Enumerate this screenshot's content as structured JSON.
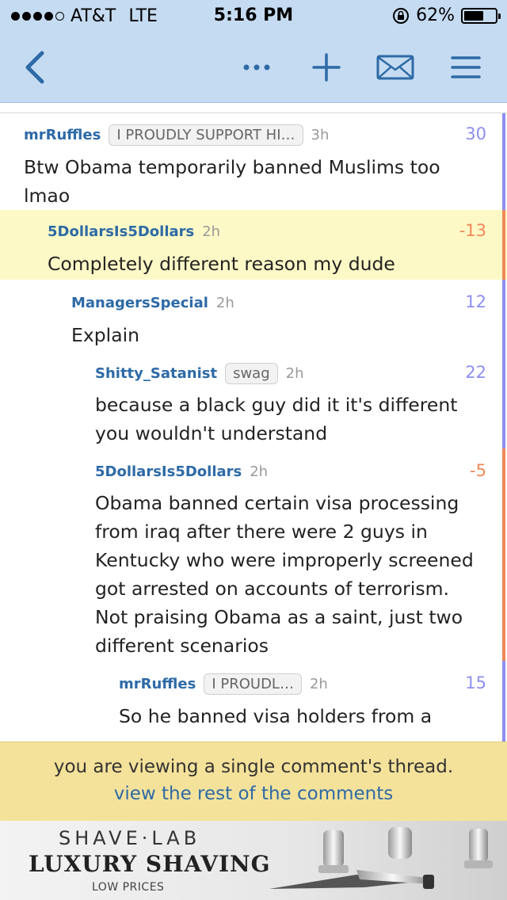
{
  "status_bar": {
    "carrier": "AT&T",
    "network": "LTE",
    "time": "5:16 PM",
    "battery": "62%",
    "battery_level": 0.62
  },
  "toolbar": {
    "icons": [
      "back-chevron-icon",
      "more-dots-icon",
      "plus-icon",
      "envelope-icon",
      "hamburger-menu-icon"
    ]
  },
  "comments": [
    {
      "author": "mrRuffles",
      "flair": "I PROUDLY SUPPORT HI…",
      "age": "3h",
      "score": "30",
      "body": [
        "Btw Obama temporarily banned Muslims too",
        "lmao"
      ]
    },
    {
      "author": "5DollarsIs5Dollars",
      "flair": "",
      "age": "2h",
      "score": "-13",
      "body": [
        "Completely different reason my dude"
      ]
    },
    {
      "author": "ManagersSpecial",
      "flair": "",
      "age": "2h",
      "score": "12",
      "body": [
        "Explain"
      ]
    },
    {
      "author": "Shitty_Satanist",
      "flair": "swag",
      "age": "2h",
      "score": "22",
      "body": [
        "because a black guy did it it's different",
        "you wouldn't understand"
      ]
    },
    {
      "author": "5DollarsIs5Dollars",
      "flair": "",
      "age": "2h",
      "score": "-5",
      "body": [
        "Obama banned certain visa processing",
        "from iraq after there were 2 guys in",
        "Kentucky who were improperly screened",
        "got arrested on accounts of terrorism.",
        "Not praising Obama as a saint, just two",
        "different scenarios"
      ]
    },
    {
      "author": "mrRuffles",
      "flair": "I PROUDL…",
      "age": "2h",
      "score": "15",
      "body": [
        "So he banned visa holders from a"
      ]
    }
  ],
  "banner": {
    "notice": "you are viewing a single comment's thread.",
    "link": "view the rest of the comments"
  },
  "ad": {
    "brand": "SHAVE·LAB",
    "tagline": "LUXURY SHAVING",
    "sub": "LOW PRICES"
  },
  "colors": {
    "header_bg": "#c5dbf1",
    "icon_blue": "#2d6aa6",
    "author": "#2d6aa6",
    "score_positive": "#8c8ff0",
    "score_negative": "#f08858",
    "highlight": "#fdf9c6",
    "banner_bg": "#f5e29a"
  }
}
